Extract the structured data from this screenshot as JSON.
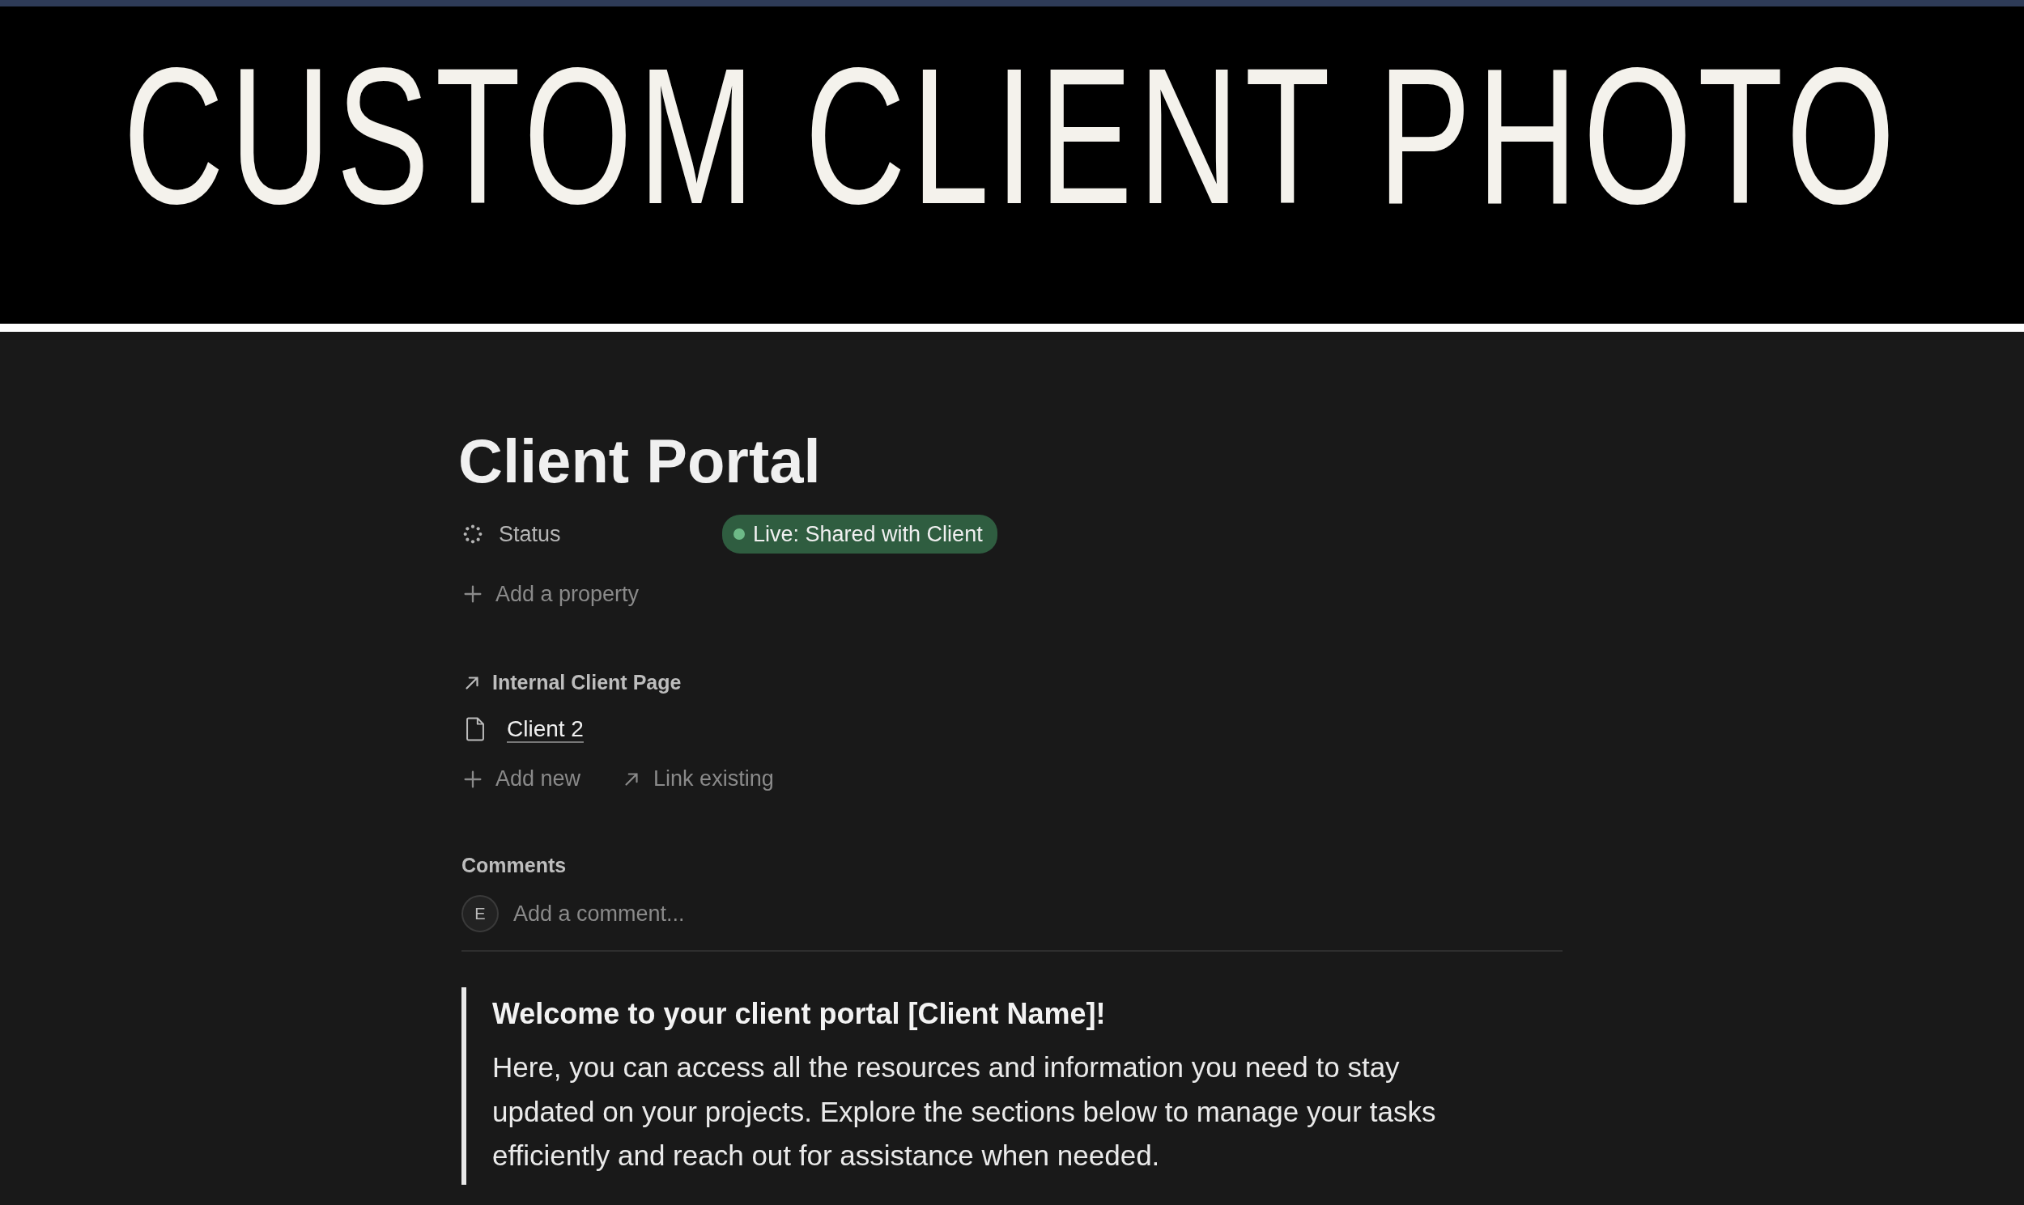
{
  "cover": {
    "text": "CUSTOM CLIENT PHOTO"
  },
  "title": "Client Portal",
  "properties": [
    {
      "kind": "status",
      "label": "Status",
      "value": "Live: Shared with Client"
    }
  ],
  "add_property": "Add a property",
  "relation": {
    "label": "Internal Client Page",
    "pages": [
      "Client 2"
    ],
    "actions": [
      {
        "kind": "add",
        "label": "Add new"
      },
      {
        "kind": "link",
        "label": "Link existing"
      }
    ]
  },
  "comments": {
    "heading": "Comments",
    "avatar": "E",
    "placeholder": "Add a comment..."
  },
  "quote": {
    "heading": "Welcome to your client portal [Client Name]!",
    "body": "Here, you can access all the resources and information you need to stay updated on your projects. Explore the sections below to manage your tasks efficiently and reach out for assistance when needed."
  }
}
